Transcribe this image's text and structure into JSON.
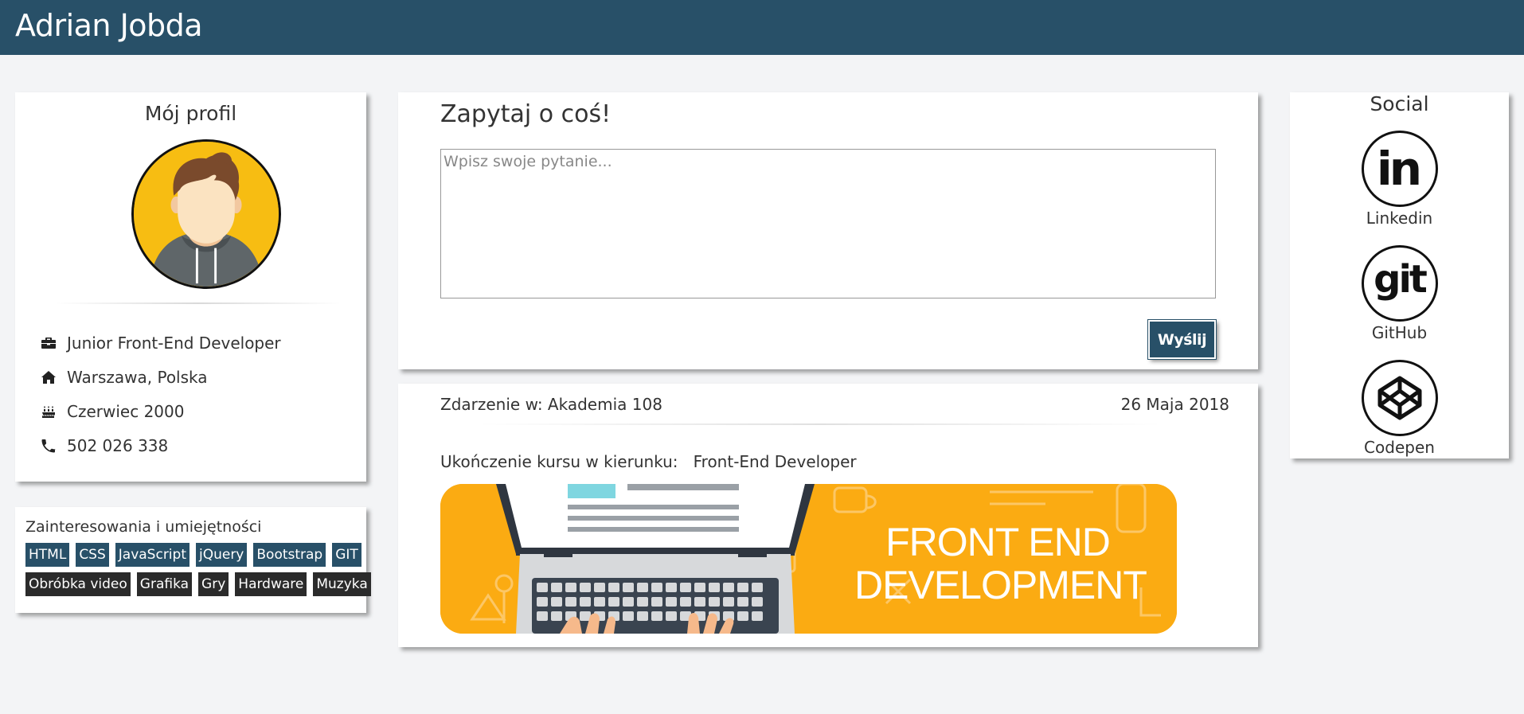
{
  "header": {
    "brand": "Adrian Jobda",
    "color": "#285068"
  },
  "profile": {
    "title": "Mój profil",
    "info": [
      {
        "icon": "briefcase-icon",
        "text": "Junior Front-End Developer"
      },
      {
        "icon": "home-icon",
        "text": "Warszawa, Polska"
      },
      {
        "icon": "birthday-cake-icon",
        "text": "Czerwiec 2000"
      },
      {
        "icon": "phone-icon",
        "text": "502 026 338"
      }
    ]
  },
  "skills": {
    "title": "Zainteresowania i umiejętności",
    "tech": [
      "HTML",
      "CSS",
      "JavaScript",
      "jQuery",
      "Bootstrap",
      "GIT"
    ],
    "hobbies": [
      "Obróbka video",
      "Grafika",
      "Gry",
      "Hardware",
      "Muzyka"
    ]
  },
  "ask": {
    "title": "Zapytaj o coś!",
    "placeholder": "Wpisz swoje pytanie...",
    "value": "",
    "send_label": "Wyślij"
  },
  "event": {
    "place": "Zdarzenie w: Akademia 108",
    "date": "26 Maja 2018",
    "text": "Ukończenie kursu w kierunku:   Front-End Developer",
    "banner": {
      "line1": "FRONT END",
      "line2": "DEVELOPMENT",
      "bg": "#fbab12"
    }
  },
  "social": {
    "title": "Social",
    "items": [
      {
        "icon": "linkedin-icon",
        "glyph": "in",
        "label": "Linkedin"
      },
      {
        "icon": "github-icon",
        "glyph": "git",
        "label": "GitHub"
      },
      {
        "icon": "codepen-icon",
        "glyph": "",
        "label": "Codepen"
      }
    ]
  }
}
